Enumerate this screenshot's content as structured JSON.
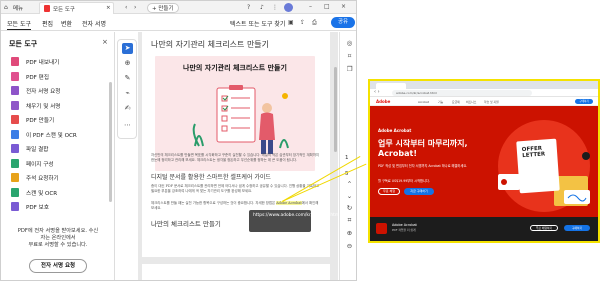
{
  "titlebar": {
    "menu_label": "메뉴",
    "home_tab": "모든 도구",
    "new_tab": "+ 만들기"
  },
  "toolbar": {
    "menus": [
      "모든 도구",
      "편집",
      "변환",
      "전자 서명"
    ],
    "search_placeholder": "텍스트 또는 도구 찾기",
    "share": "공유"
  },
  "leftpanel": {
    "title": "모든 도구",
    "tools": [
      {
        "label": "PDF 내보내기",
        "color": "#e04a7a"
      },
      {
        "label": "PDF 편집",
        "color": "#e0508f"
      },
      {
        "label": "전자 서명 요청",
        "color": "#8e54c9"
      },
      {
        "label": "채우기 및 서명",
        "color": "#8f57c8"
      },
      {
        "label": "PDF 만들기",
        "color": "#e64c4c"
      },
      {
        "label": "이 PDF 스캔 및 OCR",
        "color": "#3c7ee6"
      },
      {
        "label": "파일 결합",
        "color": "#7a5bd4"
      },
      {
        "label": "페이지 구성",
        "color": "#2aa56f"
      },
      {
        "label": "주석 요청하기",
        "color": "#e7a21a"
      },
      {
        "label": "스캔 및 OCR",
        "color": "#2aa56f"
      },
      {
        "label": "PDF 보호",
        "color": "#7a5bd4"
      }
    ],
    "footer_lines": [
      "PDF에 전자 서명을 받아보세요. 수신",
      "자는 온라인에서",
      "무료로 서명할 수 있습니다."
    ],
    "trial_button": "전자 서명 요청"
  },
  "document": {
    "heading1": "나만의 자기관리 체크리스트 만들기",
    "card_title": "나만의 자기관리 체크리스트 만들기",
    "heading2": "디지털 문서를 활용한 스마트한 셀프케어 가이드",
    "paragraph1": "자신만의 체크리스트를 만들면 목표를 시각화하고 꾸준히 실천할 수 있습니다. 매일의 작은 습관부터 장기적인 계획까지 한눈에 정리하고 관리해 보세요. 체크리스트는 생각을 정돈하고 우선순위를 정하는 데 큰 도움이 됩니다.",
    "paragraph2": "종이 대신 PDF 문서로 체크리스트를 관리하면 언제 어디서나 쉽게 수정하고 공유할 수 있습니다. 진행 상황을 기록하고 필요한 부분을 강조하여 나에게 꼭 맞는 자기관리 도구를 완성해 보세요.",
    "paragraph3": "체크리스트를 만들 때는 실천 가능한 항목으로 구성하는 것이 중요합니다. 자세한 방법은",
    "link_text": "Adobe Acrobat",
    "paragraph3_end": "에서 확인해 보세요.",
    "heading3": "나만의 체크리스트 만들기",
    "tooltip_url": "https://www.adobe.com/kr/acrobat.html"
  },
  "rightstrip": {
    "page_current": "1",
    "page_total": "5"
  },
  "preview": {
    "url": "adobe.com/kr/acrobat.html",
    "brand": "Adobe",
    "nav_items": [
      "Acrobat",
      "기능",
      "요금제",
      "비즈니스",
      "학습 및 지원"
    ],
    "buy": "구매하기",
    "hero_tag": "Adobe Acrobat",
    "hero_title": [
      "업무 시작부터 마무리까지,",
      "Acrobat!"
    ],
    "hero_desc": "PDF 작성 및 편집부터 전자 서명까지 Acrobat 하나로 해결하세요.",
    "hero_note": "월 구독료 US$19.99부터 시작합니다.",
    "btn_trial": "무료 체험",
    "btn_buy": "지금 구매하기",
    "offer_letter": [
      "OFFER",
      "LETTER"
    ],
    "bottom_name": "Adobe Acrobat",
    "bottom_sub": "PDF 작업을 더 쉽게",
    "bottom_btn1": "무료 체험하기",
    "bottom_btn2": "구매하기"
  },
  "colors": {
    "accent": "#1a73e8",
    "adobe_red": "#cc1200",
    "highlight": "#f4e200"
  }
}
